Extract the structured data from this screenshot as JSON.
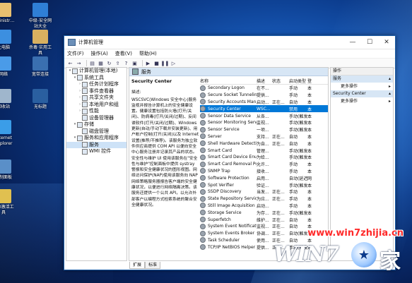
{
  "desktop": {
    "icons": [
      {
        "label": "dministr…",
        "color": "#e8c070"
      },
      {
        "label": "中级-安全网\n站大全",
        "color": "#2f7fd6"
      },
      {
        "label": "此电脑",
        "color": "#3c8fe0"
      },
      {
        "label": "杀毒·实用工\n具",
        "color": "#d8b060"
      },
      {
        "label": "网络",
        "color": "#4a9be8"
      },
      {
        "label": "宽带连接",
        "color": "#3a6fb0"
      },
      {
        "label": "回收站",
        "color": "#9fb6cc"
      },
      {
        "label": "无标题",
        "color": "#2a5fa0"
      },
      {
        "label": "Internet\nExplorer",
        "color": "#3b9de8"
      },
      {
        "label": "控制面板",
        "color": "#5a8fc8"
      },
      {
        "label": "n10激活工\n具",
        "color": "#e0c050"
      }
    ]
  },
  "window": {
    "title": "计算机管理",
    "menu": [
      "文件(F)",
      "操作(A)",
      "查看(V)",
      "帮助(H)"
    ],
    "tree": [
      {
        "label": "计算机管理(本地)",
        "level": 0,
        "exp": "▾"
      },
      {
        "label": "系统工具",
        "level": 1,
        "exp": "▾"
      },
      {
        "label": "任务计划程序",
        "level": 2,
        "exp": "›"
      },
      {
        "label": "事件查看器",
        "level": 2,
        "exp": "›"
      },
      {
        "label": "共享文件夹",
        "level": 2,
        "exp": "›"
      },
      {
        "label": "本地用户和组",
        "level": 2,
        "exp": "›"
      },
      {
        "label": "性能",
        "level": 2,
        "exp": "›"
      },
      {
        "label": "设备管理器",
        "level": 2,
        "exp": ""
      },
      {
        "label": "存储",
        "level": 1,
        "exp": "▾"
      },
      {
        "label": "磁盘管理",
        "level": 2,
        "exp": ""
      },
      {
        "label": "服务和应用程序",
        "level": 1,
        "exp": "▾"
      },
      {
        "label": "服务",
        "level": 2,
        "exp": "",
        "selected": true
      },
      {
        "label": "WMI 控件",
        "level": 2,
        "exp": ""
      }
    ],
    "services_header": "服务",
    "description": {
      "title": "Security Center",
      "label": "描述:",
      "text": "WSCSVC(Windows 安全中心)服务监视并报告计算机上的安全健康设置。健康设置包括防火墙(打开/关闭)、防病毒(打开/关闭/过期)、反间谍软件(打开/关闭/过期)、Windows 更新(自动/手动下载并安装更新)、用户帐户控制(打开/关闭)以及 Internet 设置(推荐/不推荐)。该服务为独立软件供应商提供 COM API 以便向安全中心服务注册并记录其产品的状态。安全性与维护 UI 使用该服务在\"安全性与维护\"控制面板中提供 systray 警报和安全健康状况的图形视图。网络访问保护(NAP)使用该服务向 NAP 网络策略服务器报告客户端的安全健康状况，以便进行网络隔离决策。该服务还提供一个公共 API，以允许外部客户以编程方式检索系统的聚合安全健康状况。"
    },
    "columns": [
      "名称",
      "描述",
      "状态",
      "启动类型",
      "登"
    ],
    "services": [
      {
        "name": "Secondary Logon",
        "desc": "在不...",
        "status": "",
        "startup": "手动",
        "logon": "本"
      },
      {
        "name": "Secure Socket Tunneling ...",
        "desc": "提供...",
        "status": "",
        "startup": "手动",
        "logon": "本"
      },
      {
        "name": "Security Accounts Manag...",
        "desc": "启动...",
        "status": "正在...",
        "startup": "自动",
        "logon": "本"
      },
      {
        "name": "Security Center",
        "desc": "WSC...",
        "status": "",
        "startup": "禁用",
        "logon": "本",
        "selected": true
      },
      {
        "name": "Sensor Data Service",
        "desc": "从各...",
        "status": "",
        "startup": "手动(触发...",
        "logon": "本"
      },
      {
        "name": "Sensor Monitoring Service",
        "desc": "监视...",
        "status": "",
        "startup": "手动(触发...",
        "logon": "本"
      },
      {
        "name": "Sensor Service",
        "desc": "一项...",
        "status": "",
        "startup": "手动(触发...",
        "logon": "本"
      },
      {
        "name": "Server",
        "desc": "支持...",
        "status": "正在...",
        "startup": "自动",
        "logon": "本"
      },
      {
        "name": "Shell Hardware Detection",
        "desc": "为自...",
        "status": "正在...",
        "startup": "自动",
        "logon": "本"
      },
      {
        "name": "Smart Card",
        "desc": "管理...",
        "status": "",
        "startup": "手动(触发...",
        "logon": "本"
      },
      {
        "name": "Smart Card Device Enum...",
        "desc": "为给...",
        "status": "",
        "startup": "手动(触发...",
        "logon": "本"
      },
      {
        "name": "Smart Card Removal Poli...",
        "desc": "允许...",
        "status": "",
        "startup": "手动",
        "logon": "本"
      },
      {
        "name": "SNMP Trap",
        "desc": "接收...",
        "status": "",
        "startup": "手动",
        "logon": "本"
      },
      {
        "name": "Software Protection",
        "desc": "启用...",
        "status": "",
        "startup": "自动(延迟...",
        "logon": "网"
      },
      {
        "name": "Spot Verifier",
        "desc": "验证...",
        "status": "",
        "startup": "手动(触发...",
        "logon": "本"
      },
      {
        "name": "SSDP Discovery",
        "desc": "当发...",
        "status": "正在...",
        "startup": "手动",
        "logon": "本"
      },
      {
        "name": "State Repository Service",
        "desc": "为应...",
        "status": "正在...",
        "startup": "手动",
        "logon": "本"
      },
      {
        "name": "Still Image Acquisition Ev...",
        "desc": "启动...",
        "status": "",
        "startup": "手动",
        "logon": "本"
      },
      {
        "name": "Storage Service",
        "desc": "为存...",
        "status": "正在...",
        "startup": "手动(触发...",
        "logon": "本"
      },
      {
        "name": "Superfetch",
        "desc": "维护...",
        "status": "正在...",
        "startup": "自动",
        "logon": "本"
      },
      {
        "name": "System Event Notification...",
        "desc": "监视...",
        "status": "正在...",
        "startup": "自动",
        "logon": "本"
      },
      {
        "name": "System Events Broker",
        "desc": "协调...",
        "status": "正在...",
        "startup": "自动(触发...",
        "logon": "本"
      },
      {
        "name": "Task Scheduler",
        "desc": "使用...",
        "status": "正在...",
        "startup": "自动",
        "logon": "本"
      },
      {
        "name": "TCP/IP NetBIOS Helper",
        "desc": "提供...",
        "status": "正在...",
        "startup": "手动(触发...",
        "logon": "本"
      }
    ],
    "tabs": [
      "扩展",
      "标准"
    ],
    "actions": {
      "title": "操作",
      "section1": "服务",
      "more1": "更多操作",
      "section2": "Security Center",
      "more2": "更多操作"
    }
  },
  "watermark": {
    "url": "www.win7zhijia.cn",
    "logo": "WIN7",
    "jia": "家"
  }
}
